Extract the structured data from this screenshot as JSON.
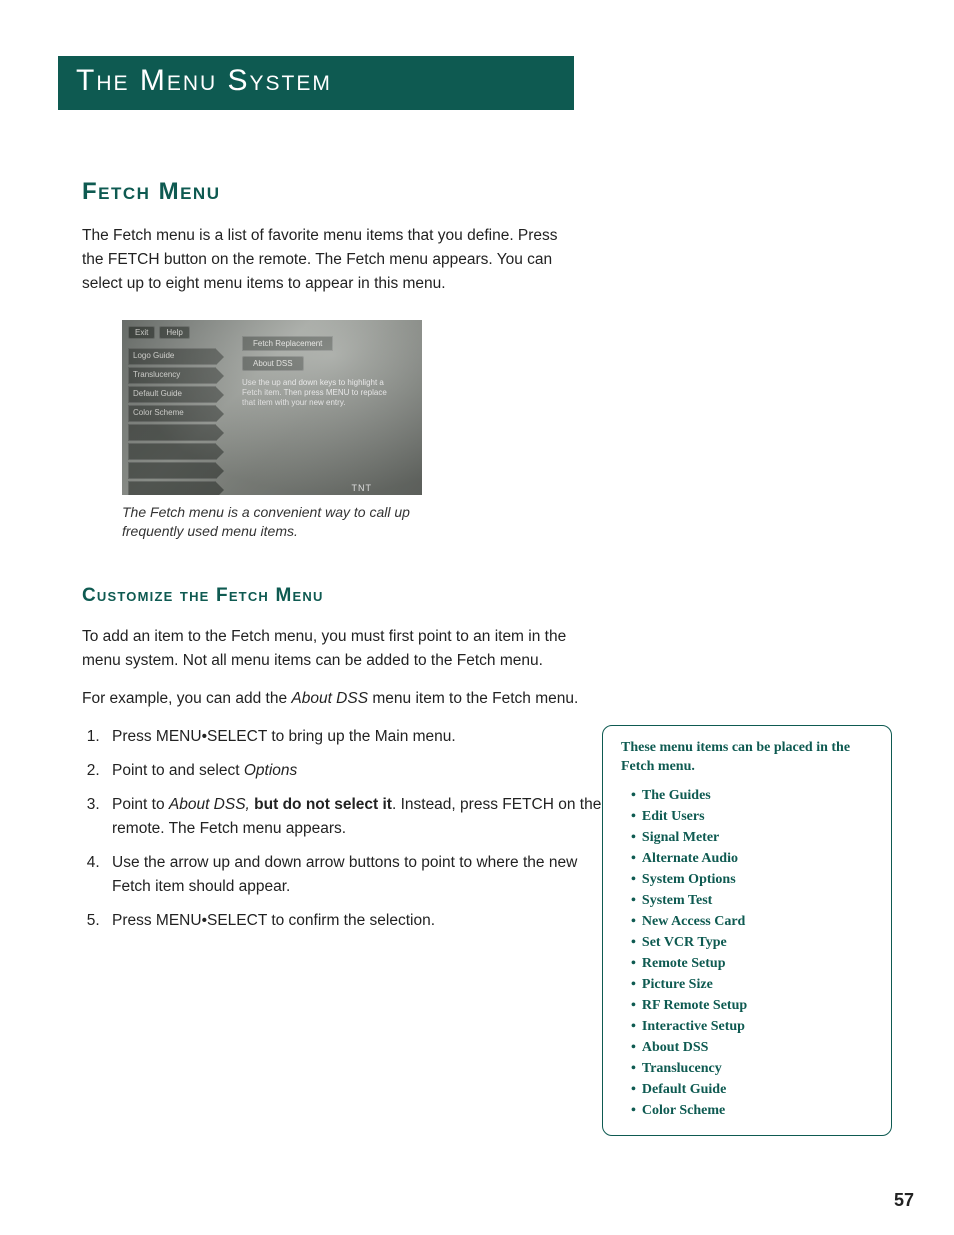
{
  "chapter_title": "The Menu System",
  "section": {
    "heading": "Fetch Menu",
    "intro": "The Fetch menu is a list of favorite menu items that you define. Press the FETCH button on the remote. The Fetch menu appears. You can select up to eight menu items to appear in this menu."
  },
  "tv": {
    "btn_exit": "Exit",
    "btn_help": "Help",
    "left_items": [
      "Logo Guide",
      "Translucency",
      "Default Guide",
      "Color Scheme",
      "",
      "",
      "",
      ""
    ],
    "panel_title": "Fetch Replacement",
    "pill": "About DSS",
    "hint": "Use the up and down keys to highlight a Fetch item. Then press MENU to replace that item with your new entry.",
    "corner": "TNT"
  },
  "caption": "The Fetch menu is a convenient way to call up frequently used menu items.",
  "customize": {
    "heading": "Customize the Fetch Menu",
    "para1": "To add an item to the Fetch menu, you must first point to an item in the menu system. Not all menu items can be added to the Fetch menu.",
    "para2_a": "For example, you can add the ",
    "para2_em": "About DSS",
    "para2_b": " menu item to the Fetch menu.",
    "steps": {
      "s1": "Press MENU•SELECT to bring up the Main menu.",
      "s2_a": "Point to and select ",
      "s2_em": "Options",
      "s3_a": "Point to ",
      "s3_em": "About DSS,",
      "s3_b": " but do not select it",
      "s3_c": ". Instead, press FETCH on the remote. The Fetch menu appears.",
      "s4": "Use the arrow up and down arrow buttons to point to where the new Fetch item should appear.",
      "s5": "Press MENU•SELECT to confirm the selection."
    }
  },
  "sidebar": {
    "intro": "These menu items can be placed in the Fetch menu.",
    "items": [
      "The Guides",
      "Edit Users",
      "Signal Meter",
      "Alternate Audio",
      "System Options",
      "System Test",
      "New Access Card",
      "Set VCR Type",
      "Remote Setup",
      "Picture Size",
      "RF Remote Setup",
      "Interactive Setup",
      "About DSS",
      "Translucency",
      "Default Guide",
      "Color Scheme"
    ]
  },
  "page_number": "57"
}
